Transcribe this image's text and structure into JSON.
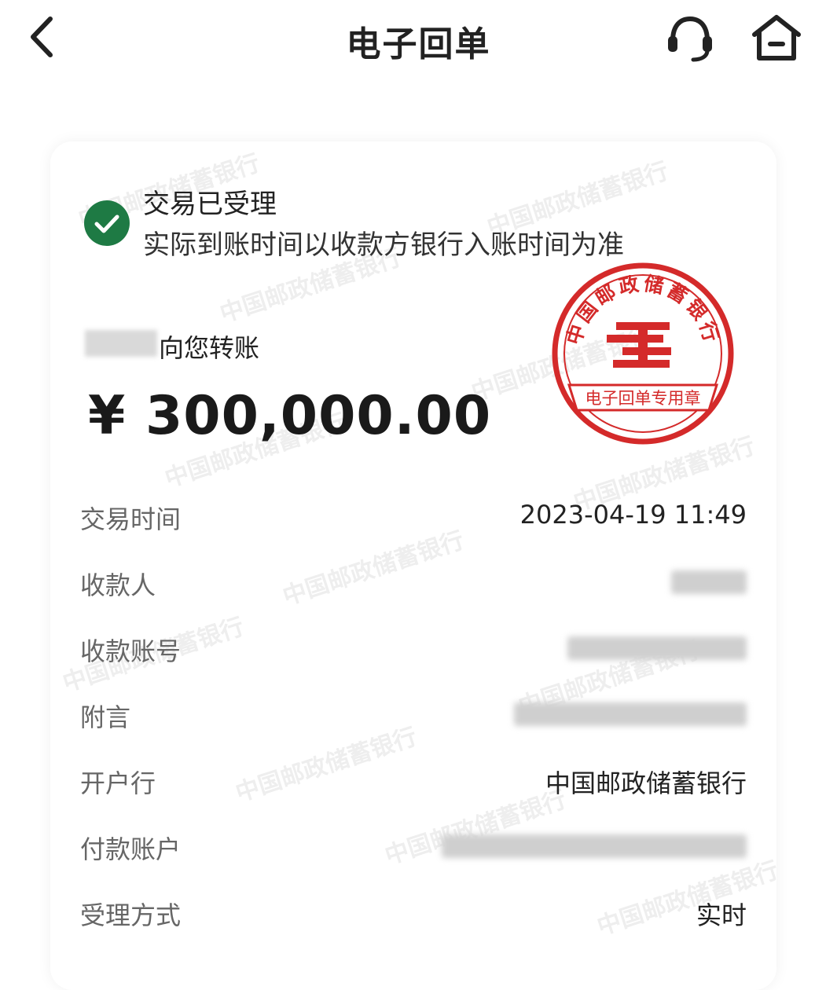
{
  "header": {
    "title": "电子回单",
    "back_icon": "chevron-left-icon",
    "service_icon": "headset-icon",
    "home_icon": "home-icon"
  },
  "status": {
    "title": "交易已受理",
    "subtitle": "实际到账时间以收款方银行入账时间为准",
    "icon": "check-circle-icon",
    "color": "#1e7a44"
  },
  "transfer": {
    "text": "向您转账",
    "amount": "¥ 300,000.00"
  },
  "seal": {
    "bank_name": "中国邮政储蓄银行",
    "label": "电子回单专用章",
    "color": "#d42a2a"
  },
  "watermark": {
    "text": "中国邮政储蓄银行"
  },
  "details": [
    {
      "label": "交易时间",
      "value": "2023-04-19 11:49"
    },
    {
      "label": "收款人",
      "value": ""
    },
    {
      "label": "收款账号",
      "value": ""
    },
    {
      "label": "附言",
      "value": ""
    },
    {
      "label": "开户行",
      "value": "中国邮政储蓄银行"
    },
    {
      "label": "付款账户",
      "value": ""
    },
    {
      "label": "受理方式",
      "value": "实时"
    }
  ]
}
